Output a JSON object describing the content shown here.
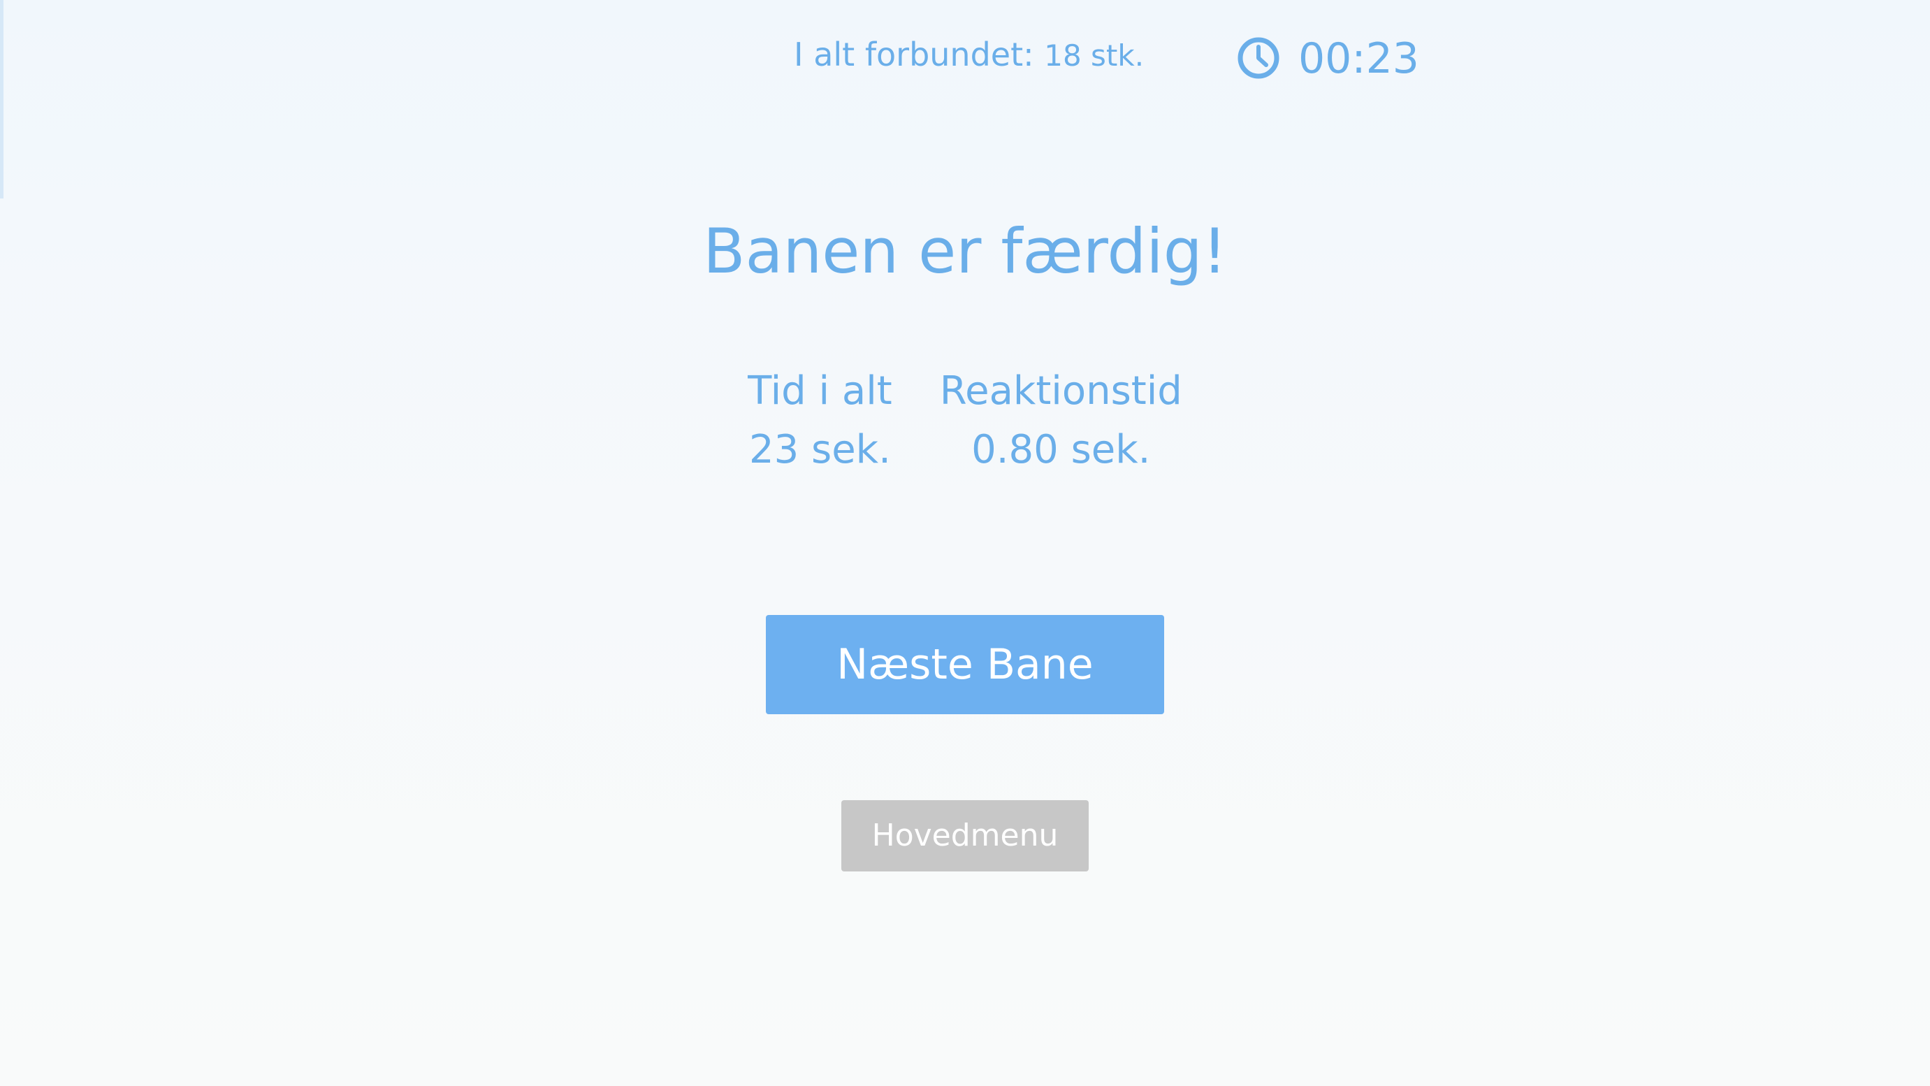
{
  "hud": {
    "connected_label": "I alt forbundet:",
    "connected_value": "18 stk.",
    "clock_icon": "clock-icon",
    "timer": "00:23"
  },
  "result": {
    "title": "Banen er færdig!",
    "stats": [
      {
        "label": "Tid i alt",
        "value": "23 sek."
      },
      {
        "label": "Reaktionstid",
        "value": "0.80 sek."
      }
    ]
  },
  "actions": {
    "next_level": "Næste Bane",
    "main_menu": "Hovedmenu"
  },
  "colors": {
    "accent": "#6aaee9",
    "primary_button": "#6db0f0",
    "secondary_button": "#c7c7c7",
    "background": "#f4f8fb"
  }
}
